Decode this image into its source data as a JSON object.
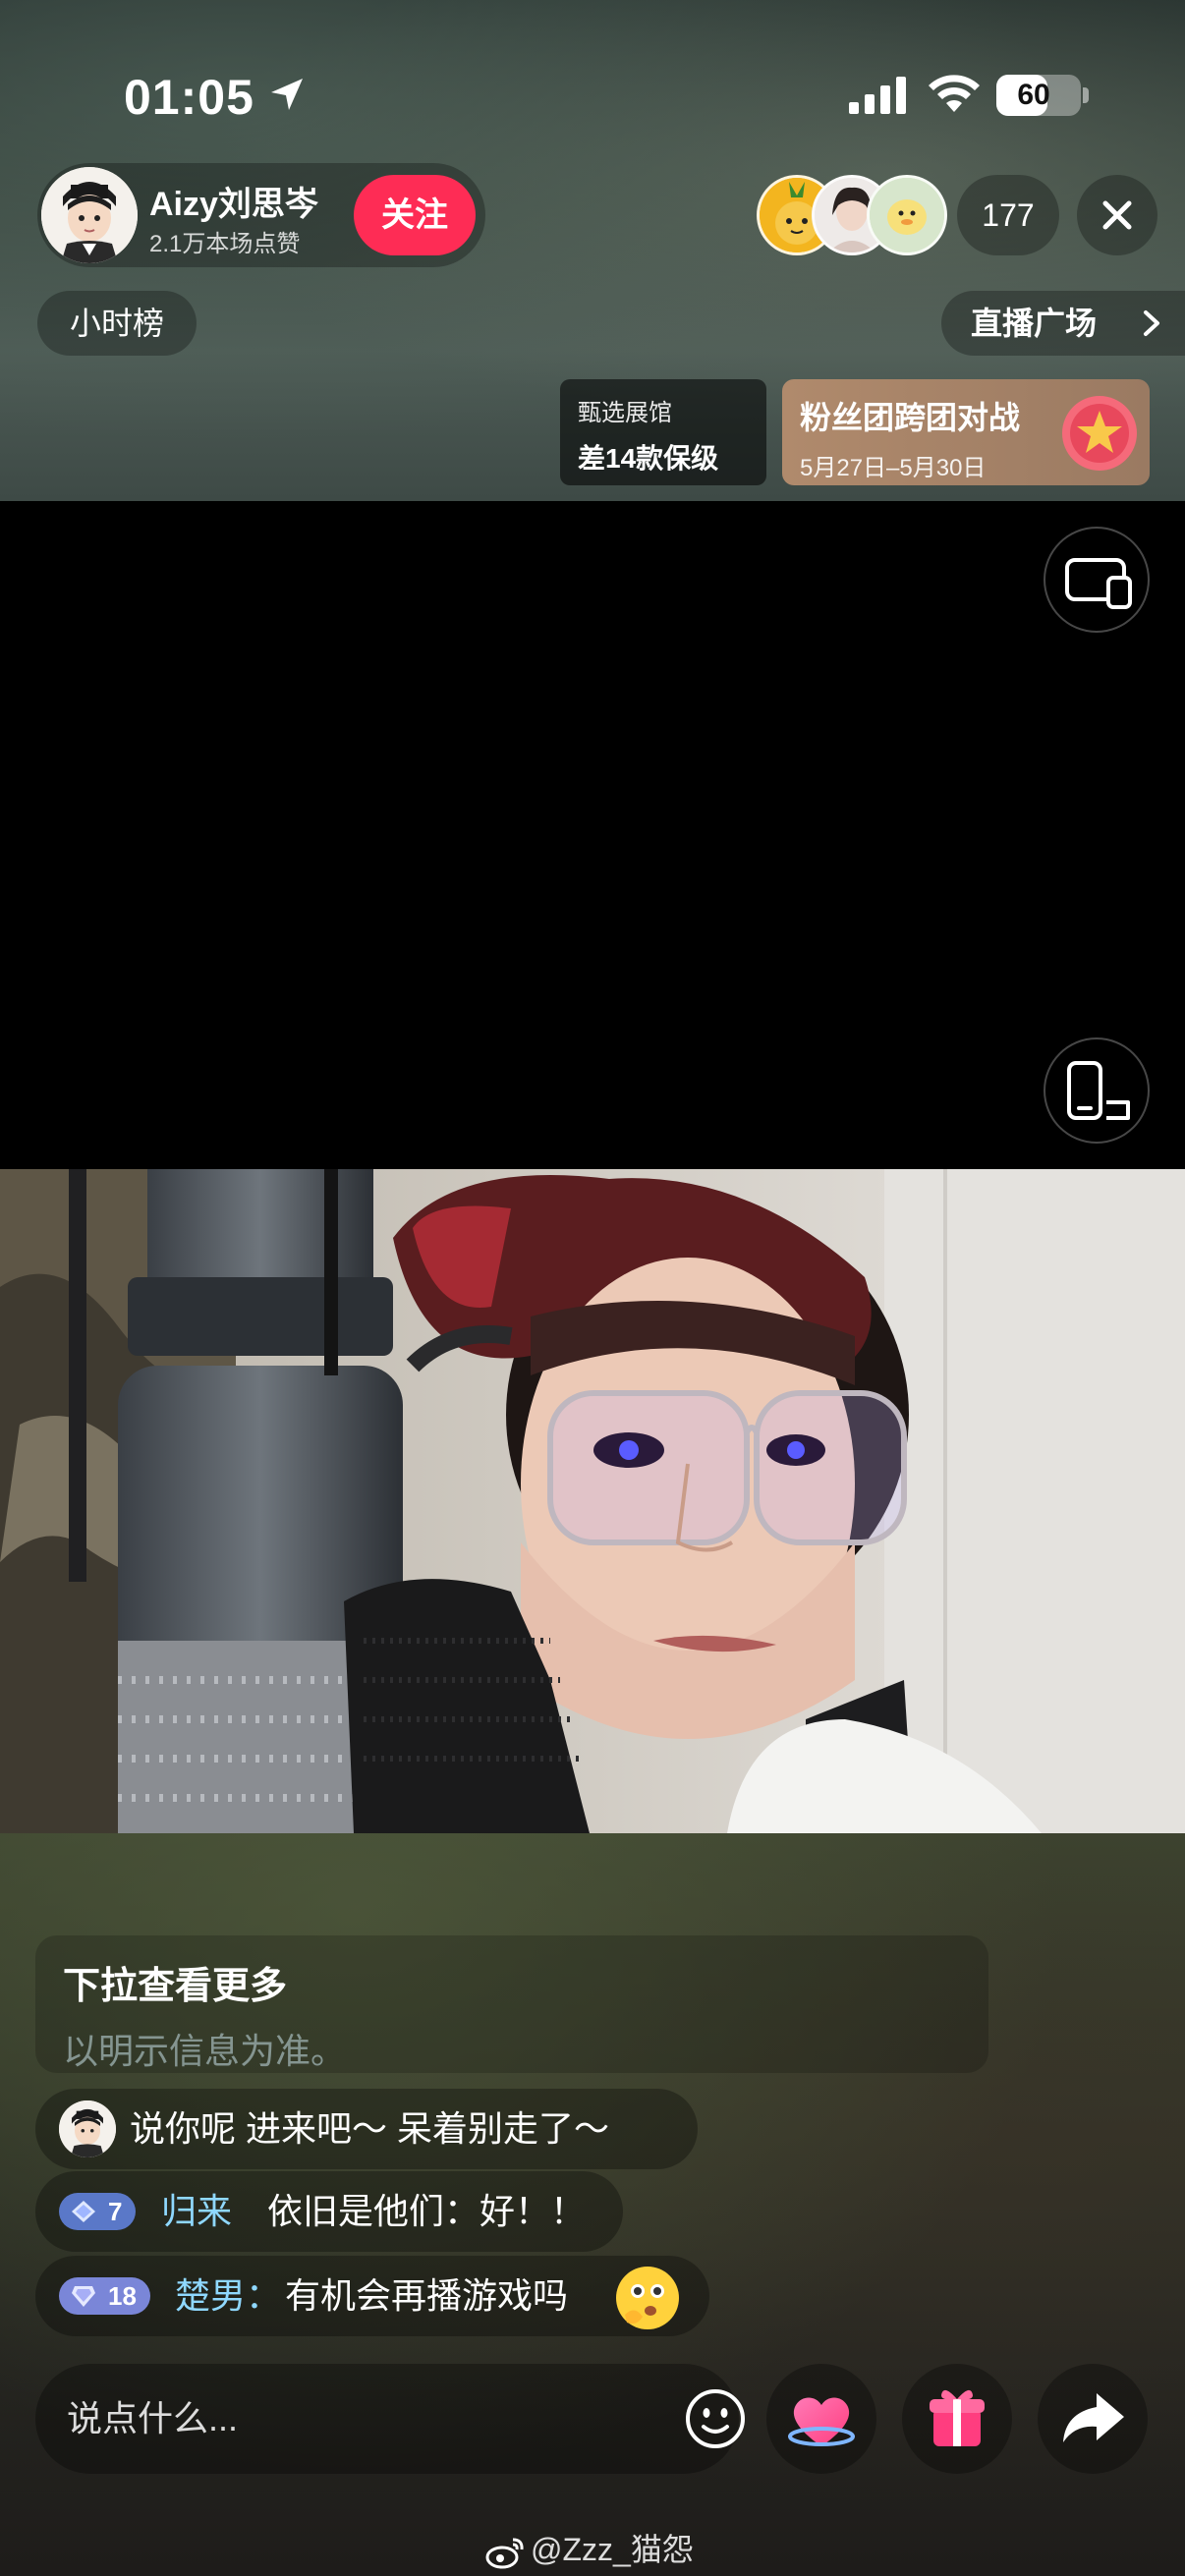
{
  "status_bar": {
    "time": "01:05",
    "battery_percent": 60,
    "battery_label": "60"
  },
  "streamer": {
    "name": "Aizy刘思岑",
    "likes": "2.1万本场点赞",
    "follow_label": "关注"
  },
  "viewers": {
    "count": "177"
  },
  "nav": {
    "hourly_rank": "小时榜",
    "live_plaza": "直播广场"
  },
  "banners": {
    "select_hall_title": "甄选展馆",
    "select_hall_sub": "差14款保级",
    "fan_battle_title": "粉丝团跨团对战",
    "fan_battle_date": "5月27日–5月30日"
  },
  "notice": {
    "title": "下拉查看更多",
    "subtitle": "以明示信息为准。"
  },
  "chat": [
    {
      "text": "说你呢 进来吧～ 呆着别走了～"
    },
    {
      "level": "7",
      "user": "归来",
      "sep": "  ",
      "text": "依旧是他们：好！！"
    },
    {
      "level": "18",
      "user": "楚男：",
      "text": "有机会再播游戏吗"
    }
  ],
  "input": {
    "placeholder": "说点什么..."
  },
  "watermark": "@Zzz_猫怨",
  "colors": {
    "follow": "#fe2c55",
    "badge_level7": "#5a78c8",
    "badge_level18": "#7a86d8",
    "chat_user": "#8fd8ff"
  }
}
